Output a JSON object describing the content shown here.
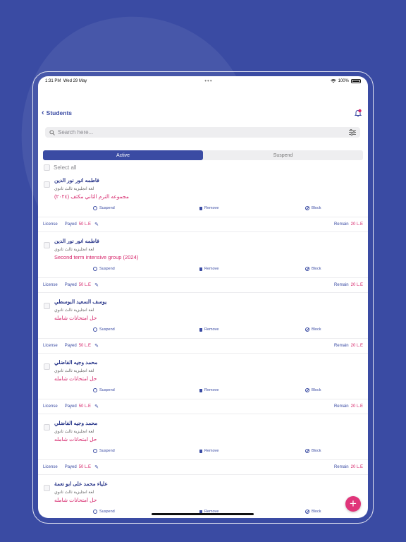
{
  "status_bar": {
    "time": "1:31 PM",
    "date": "Wed 29 May",
    "battery": "100%"
  },
  "header": {
    "back_label": "Students"
  },
  "search": {
    "placeholder": "Search here..."
  },
  "tabs": [
    {
      "label": "Active",
      "selected": true
    },
    {
      "label": "Suspend",
      "selected": false
    }
  ],
  "select_all_label": "Select all",
  "actions": {
    "suspend": "Suspend",
    "remove": "Remove",
    "block": "Block"
  },
  "license": {
    "label": "License",
    "payed_label": "Payed",
    "remain_label": "Remain"
  },
  "students": [
    {
      "name": "فاطمه انور نور الدين",
      "level": "لغة انجليزية ثالث ثانوي",
      "group": "مجموعه الترم الثاني مكثف (٢٠٢٤)",
      "payed": "50 L.E",
      "remain": "20 L.E"
    },
    {
      "name": "فاطمه انور نور الدين",
      "level": "لغة انجليزية ثالث ثانوي",
      "group": "Second term intensive group (2024)",
      "payed": "50 L.E",
      "remain": "20 L.E"
    },
    {
      "name": "يوسف السعيد البوسطي",
      "level": "لغة انجليزية ثالث ثانوي",
      "group": "حل امتحانات شامله",
      "payed": "50 L.E",
      "remain": "20 L.E"
    },
    {
      "name": "محمد وجيه الفاضلي",
      "level": "لغة انجليزية ثالث ثانوي",
      "group": "حل امتحانات شامله",
      "payed": "50 L.E",
      "remain": "20 L.E"
    },
    {
      "name": "محمد وجيه الفاضلي",
      "level": "لغة انجليزية ثالث ثانوي",
      "group": "حل امتحانات شامله",
      "payed": "50 L.E",
      "remain": "20 L.E"
    },
    {
      "name": "علياء محمد على ابو نعمة",
      "level": "لغة انجليزية ثالث ثانوي",
      "group": "حل امتحانات شامله"
    }
  ],
  "colors": {
    "primary": "#3a4ba3",
    "accent": "#d6266b",
    "fab": "#e0357a"
  },
  "icons": {
    "back": "chevron-left-icon",
    "notification": "bell-icon",
    "search": "search-icon",
    "filter": "sliders-icon",
    "suspend": "suspend-icon",
    "remove": "trash-icon",
    "block": "block-icon",
    "edit": "pencil-icon",
    "add": "plus-icon"
  }
}
